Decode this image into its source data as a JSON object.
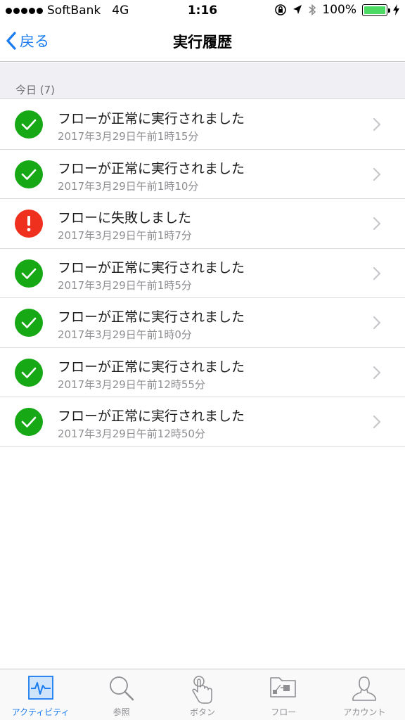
{
  "status_bar": {
    "carrier": "SoftBank",
    "network": "4G",
    "time": "1:16",
    "battery_text": "100%"
  },
  "nav": {
    "back_label": "戻る",
    "title": "実行履歴"
  },
  "section": {
    "header": "今日 (7)"
  },
  "history_items": [
    {
      "status": "success",
      "title": "フローが正常に実行されました",
      "time": "2017年3月29日午前1時15分"
    },
    {
      "status": "success",
      "title": "フローが正常に実行されました",
      "time": "2017年3月29日午前1時10分"
    },
    {
      "status": "failure",
      "title": "フローに失敗しました",
      "time": "2017年3月29日午前1時7分"
    },
    {
      "status": "success",
      "title": "フローが正常に実行されました",
      "time": "2017年3月29日午前1時5分"
    },
    {
      "status": "success",
      "title": "フローが正常に実行されました",
      "time": "2017年3月29日午前1時0分"
    },
    {
      "status": "success",
      "title": "フローが正常に実行されました",
      "time": "2017年3月29日午前12時55分"
    },
    {
      "status": "success",
      "title": "フローが正常に実行されました",
      "time": "2017年3月29日午前12時50分"
    }
  ],
  "tabs": [
    {
      "label": "アクティビティ",
      "icon": "activity-icon",
      "active": true
    },
    {
      "label": "参照",
      "icon": "search-icon",
      "active": false
    },
    {
      "label": "ボタン",
      "icon": "touch-icon",
      "active": false
    },
    {
      "label": "フロー",
      "icon": "flow-folder-icon",
      "active": false
    },
    {
      "label": "アカウント",
      "icon": "account-icon",
      "active": false
    }
  ],
  "colors": {
    "accent": "#1a7cf0",
    "success": "#17a816",
    "failure": "#f0301f",
    "battery": "#4cd964"
  }
}
